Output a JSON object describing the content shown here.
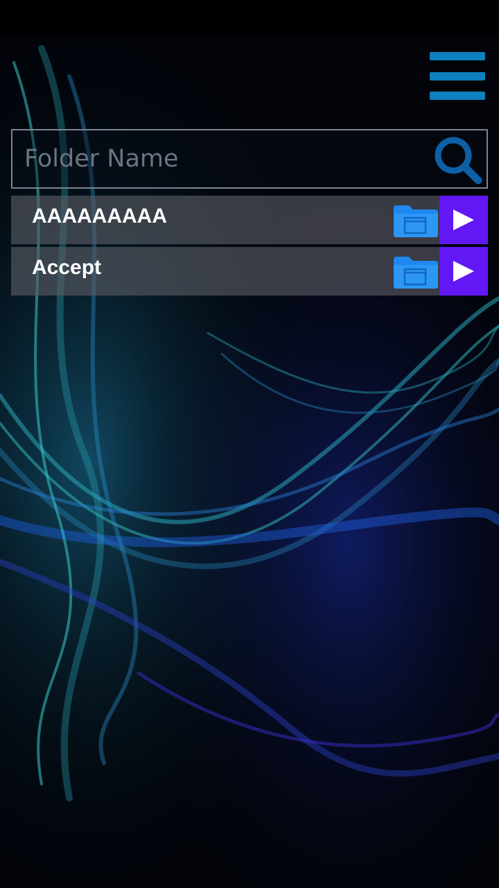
{
  "header": {
    "menu_icon": "hamburger-menu-icon",
    "accent_color": "#0e7fbf"
  },
  "search": {
    "placeholder": "Folder Name",
    "value": "",
    "icon": "search-icon"
  },
  "folders": [
    {
      "name": "AAAAAAAAA",
      "folder_icon": "folder-icon",
      "action_icon": "play-icon"
    },
    {
      "name": "Accept",
      "folder_icon": "folder-icon",
      "action_icon": "play-icon"
    }
  ],
  "colors": {
    "play_button": "#6217f5",
    "folder_icon": "#1e88f0",
    "row_background": "#5c5e65",
    "background": "#000000"
  }
}
